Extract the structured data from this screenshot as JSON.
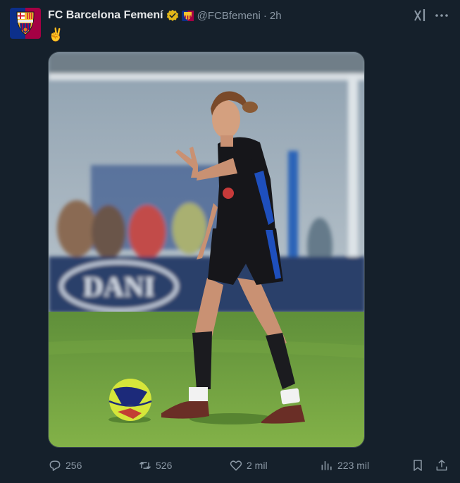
{
  "author": {
    "name": "FC Barcelona Femení",
    "handle": "@FCBfemeni",
    "separator": "·",
    "time": "2h",
    "avatar_colors": [
      "#0c2f8a",
      "#a50044"
    ],
    "verified_color": "#e2b719"
  },
  "tweet": {
    "text": "✌️"
  },
  "media": {
    "photo_icon": "photo-soccer-player",
    "banner_text": "DANI"
  },
  "actions": {
    "replies": "256",
    "retweets": "526",
    "likes": "2 mil",
    "views": "223 mil"
  },
  "icons": [
    "grok-icon",
    "more-icon",
    "reply-icon",
    "retweet-icon",
    "like-icon",
    "views-icon",
    "bookmark-icon",
    "share-icon"
  ],
  "colors": {
    "background": "#15202b",
    "text": "#e7e9ea",
    "muted": "#8b98a5"
  }
}
